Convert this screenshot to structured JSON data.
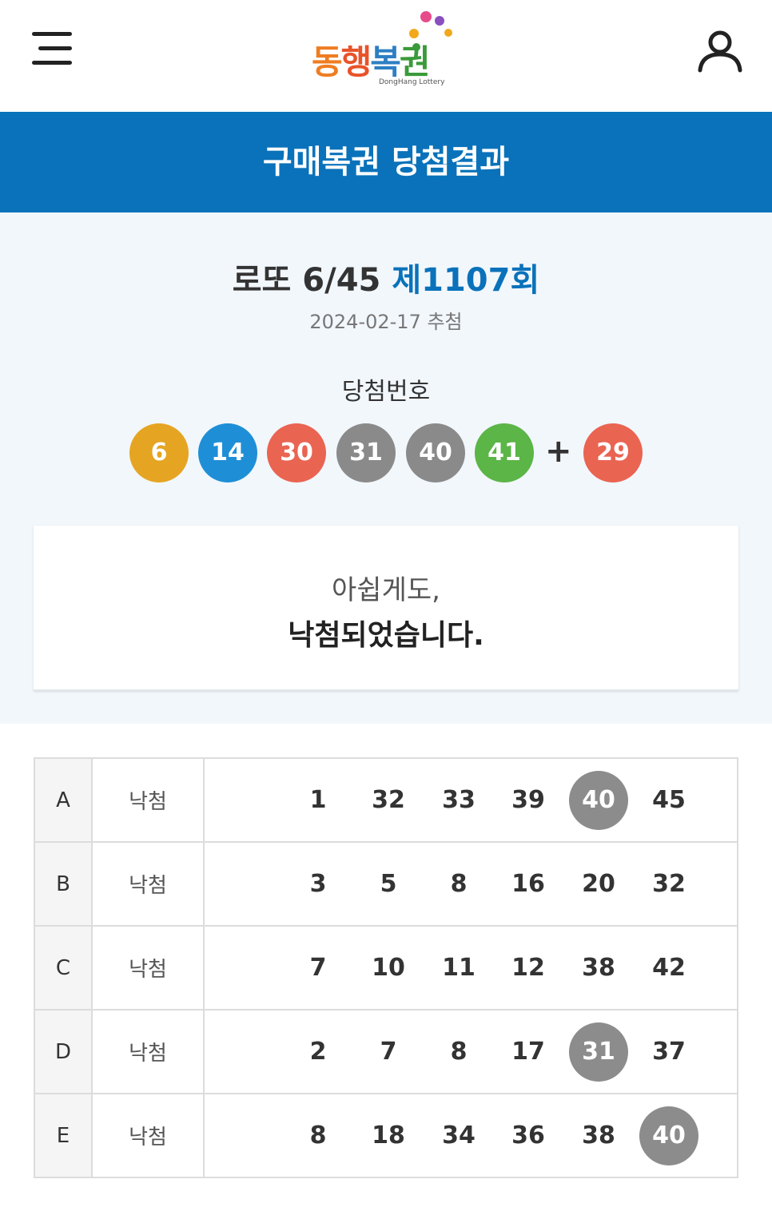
{
  "header": {
    "logo_text": "동행복권",
    "logo_sub": "DongHang Lottery"
  },
  "banner": {
    "title": "구매복권 당첨결과"
  },
  "draw": {
    "game": "로또 6/45",
    "round": "제1107회",
    "date": "2024-02-17 추첨",
    "win_label": "당첨번호",
    "numbers": [
      {
        "value": "6",
        "color": "#e5a522"
      },
      {
        "value": "14",
        "color": "#1e8fd6"
      },
      {
        "value": "30",
        "color": "#ea6452"
      },
      {
        "value": "31",
        "color": "#8a8a8a"
      },
      {
        "value": "40",
        "color": "#8a8a8a"
      },
      {
        "value": "41",
        "color": "#5bb547"
      }
    ],
    "plus": "+",
    "bonus": {
      "value": "29",
      "color": "#ea6452"
    }
  },
  "message": {
    "line1": "아쉽게도,",
    "line2": "낙첨되었습니다."
  },
  "tickets": [
    {
      "game": "A",
      "status": "낙첨",
      "numbers": [
        "1",
        "32",
        "33",
        "39",
        "40",
        "45"
      ],
      "hits": [
        false,
        false,
        false,
        false,
        true,
        false
      ]
    },
    {
      "game": "B",
      "status": "낙첨",
      "numbers": [
        "3",
        "5",
        "8",
        "16",
        "20",
        "32"
      ],
      "hits": [
        false,
        false,
        false,
        false,
        false,
        false
      ]
    },
    {
      "game": "C",
      "status": "낙첨",
      "numbers": [
        "7",
        "10",
        "11",
        "12",
        "38",
        "42"
      ],
      "hits": [
        false,
        false,
        false,
        false,
        false,
        false
      ]
    },
    {
      "game": "D",
      "status": "낙첨",
      "numbers": [
        "2",
        "7",
        "8",
        "17",
        "31",
        "37"
      ],
      "hits": [
        false,
        false,
        false,
        false,
        true,
        false
      ]
    },
    {
      "game": "E",
      "status": "낙첨",
      "numbers": [
        "8",
        "18",
        "34",
        "36",
        "38",
        "40"
      ],
      "hits": [
        false,
        false,
        false,
        false,
        false,
        true
      ]
    }
  ],
  "colors": {
    "primary": "#0a72ba",
    "hit": "#8c8c8c"
  },
  "icons": {
    "menu": "hamburger-menu-icon",
    "user": "user-icon"
  }
}
